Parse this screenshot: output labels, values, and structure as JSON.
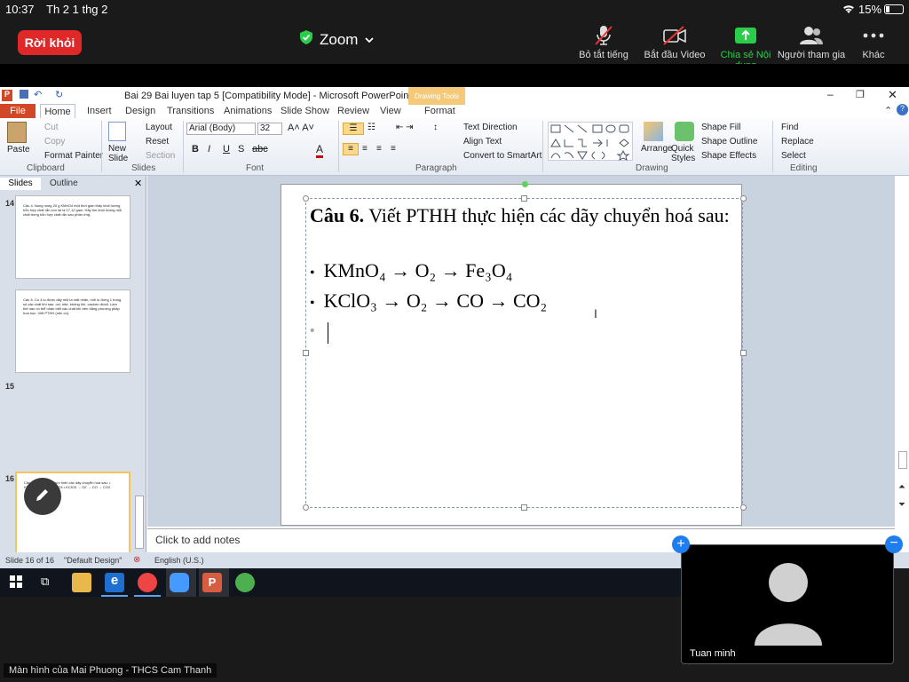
{
  "status": {
    "time": "10:37",
    "date": "Th 2 1 thg 2",
    "battery": "15%"
  },
  "zoom": {
    "leave": "Rời khỏi",
    "title": "Zoom",
    "controls": [
      {
        "label": "Bỏ tắt tiếng",
        "icon": "mic-muted-icon"
      },
      {
        "label": "Bắt đầu Video",
        "icon": "video-off-icon"
      },
      {
        "label": "Chia sẻ Nội dung",
        "icon": "share-screen-icon",
        "color": "#2bcc4a"
      },
      {
        "label": "Người tham gia",
        "icon": "participants-icon"
      },
      {
        "label": "Khác",
        "icon": "more-icon"
      }
    ]
  },
  "ppt": {
    "window_title": "Bai 29 Bai luyen tap 5 [Compatibility Mode]  -  Microsoft PowerPoint",
    "context_tab": "Drawing Tools",
    "tabs": [
      "File",
      "Home",
      "Insert",
      "Design",
      "Transitions",
      "Animations",
      "Slide Show",
      "Review",
      "View",
      "Format"
    ],
    "ribbon": {
      "paste": "Paste",
      "cut": "Cut",
      "copy": "Copy",
      "format_painter": "Format Painter",
      "clipboard": "Clipboard",
      "new_slide": "New Slide",
      "layout": "Layout",
      "reset": "Reset",
      "section": "Section",
      "slides": "Slides",
      "font_name": "Arial (Body)",
      "font_size": "32",
      "font": "Font",
      "text_direction": "Text Direction",
      "align_text": "Align Text",
      "convert_smartart": "Convert to SmartArt",
      "paragraph": "Paragraph",
      "arrange": "Arrange",
      "quick_styles": "Quick Styles",
      "shape_fill": "Shape Fill",
      "shape_outline": "Shape Outline",
      "shape_effects": "Shape Effects",
      "drawing": "Drawing",
      "find": "Find",
      "replace": "Replace",
      "select": "Select",
      "editing": "Editing"
    },
    "panel_tabs": [
      "Slides",
      "Outline"
    ],
    "thumbs": [
      {
        "num": "14",
        "text": "Câu 4. Nung nóng 20 g KMnO4 một thời gian thấy khối lượng hỗn hợp chất rắn còn lại là 17,12 gam. Hãy tìm khối lượng mỗi chất trong hỗn hợp chất rắn sau phản ứng."
      },
      {
        "num": "15",
        "text": "Câu 5. Có 4 lọ được dãy mũi là mất nhãn, mỗi lọ đựng 1 trong số các chất khí sau: oxi, nitơ, không khí, cacbon dioxit. Làm thế nào có thể nhận biết các chất khí trên bằng phương pháp hoá học. Viết PTHH (nếu có)."
      },
      {
        "num": "16",
        "text": "Câu 6. Viết PTHH thực hiện các dãy chuyển hoá sau: • KMnO4 → O2 → Fe3O4 • KClO3 → O2 → CO → CO2"
      }
    ],
    "slide": {
      "heading_bold": "Câu 6.",
      "heading_rest": " Viết PTHH thực hiện các dãy chuyển hoá sau:",
      "line1": "KMnO₄ → O₂ → Fe₃O₄",
      "line2": "KClO₃ → O₂ → CO → CO₂"
    },
    "notes": "Click to add notes",
    "statusbar": {
      "slide": "Slide 16 of 16",
      "theme": "\"Default Design\"",
      "lang": "English (U.S.)"
    }
  },
  "participant": {
    "name": "Tuan minh"
  },
  "footer": "Màn hình của Mai Phuong - THCS Cam Thanh"
}
